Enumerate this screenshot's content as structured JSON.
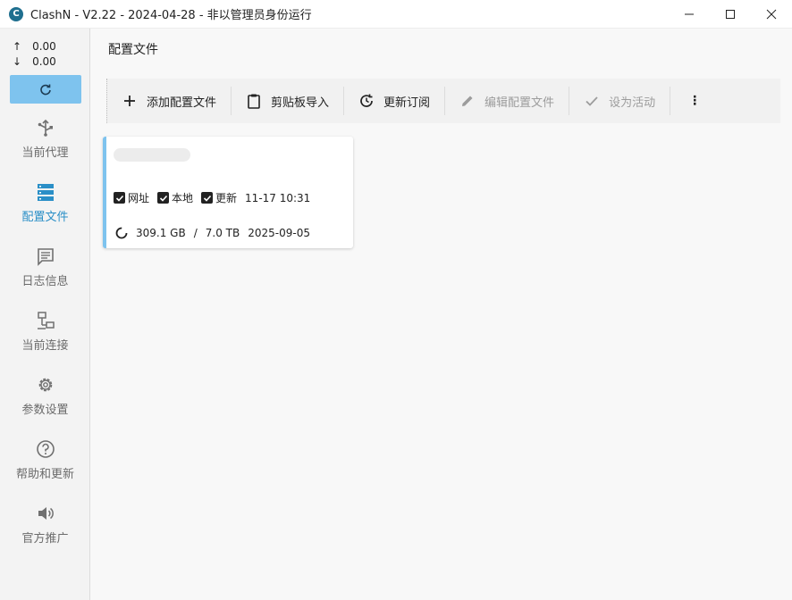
{
  "window": {
    "title": "ClashN - V2.22 - 2024-04-28 - 非以管理员身份运行",
    "app_icon_letter": "C",
    "controls": [
      "minimize-icon",
      "maximize-icon",
      "close-icon"
    ]
  },
  "sidebar": {
    "upload_speed": "0.00",
    "download_speed": "0.00",
    "upload_arrow": "↑",
    "download_arrow": "↓",
    "items": [
      {
        "label": "当前代理",
        "icon": "proxy-icon"
      },
      {
        "label": "配置文件",
        "icon": "profiles-icon",
        "active": true
      },
      {
        "label": "日志信息",
        "icon": "logs-icon"
      },
      {
        "label": "当前连接",
        "icon": "connections-icon"
      },
      {
        "label": "参数设置",
        "icon": "settings-gear-icon"
      },
      {
        "label": "帮助和更新",
        "icon": "help-icon"
      },
      {
        "label": "官方推广",
        "icon": "promotion-speaker-icon"
      }
    ]
  },
  "main": {
    "title": "配置文件",
    "toolbar": {
      "add": "添加配置文件",
      "clipboard": "剪贴板导入",
      "update": "更新订阅",
      "edit": "编辑配置文件",
      "set_active": "设为活动",
      "more": "⋮"
    },
    "profile_card": {
      "flags": [
        {
          "label": "网址",
          "checked": true
        },
        {
          "label": "本地",
          "checked": true
        },
        {
          "label": "更新",
          "checked": true
        }
      ],
      "updated_time": "11-17 10:31",
      "used": "309.1 GB",
      "separator": "/",
      "total": "7.0 TB",
      "expire_date": "2025-09-05"
    }
  },
  "colors": {
    "accent": "#2a8fc7",
    "refresh_button": "#7ec3ee",
    "card_accent": "#7ec3ee"
  }
}
